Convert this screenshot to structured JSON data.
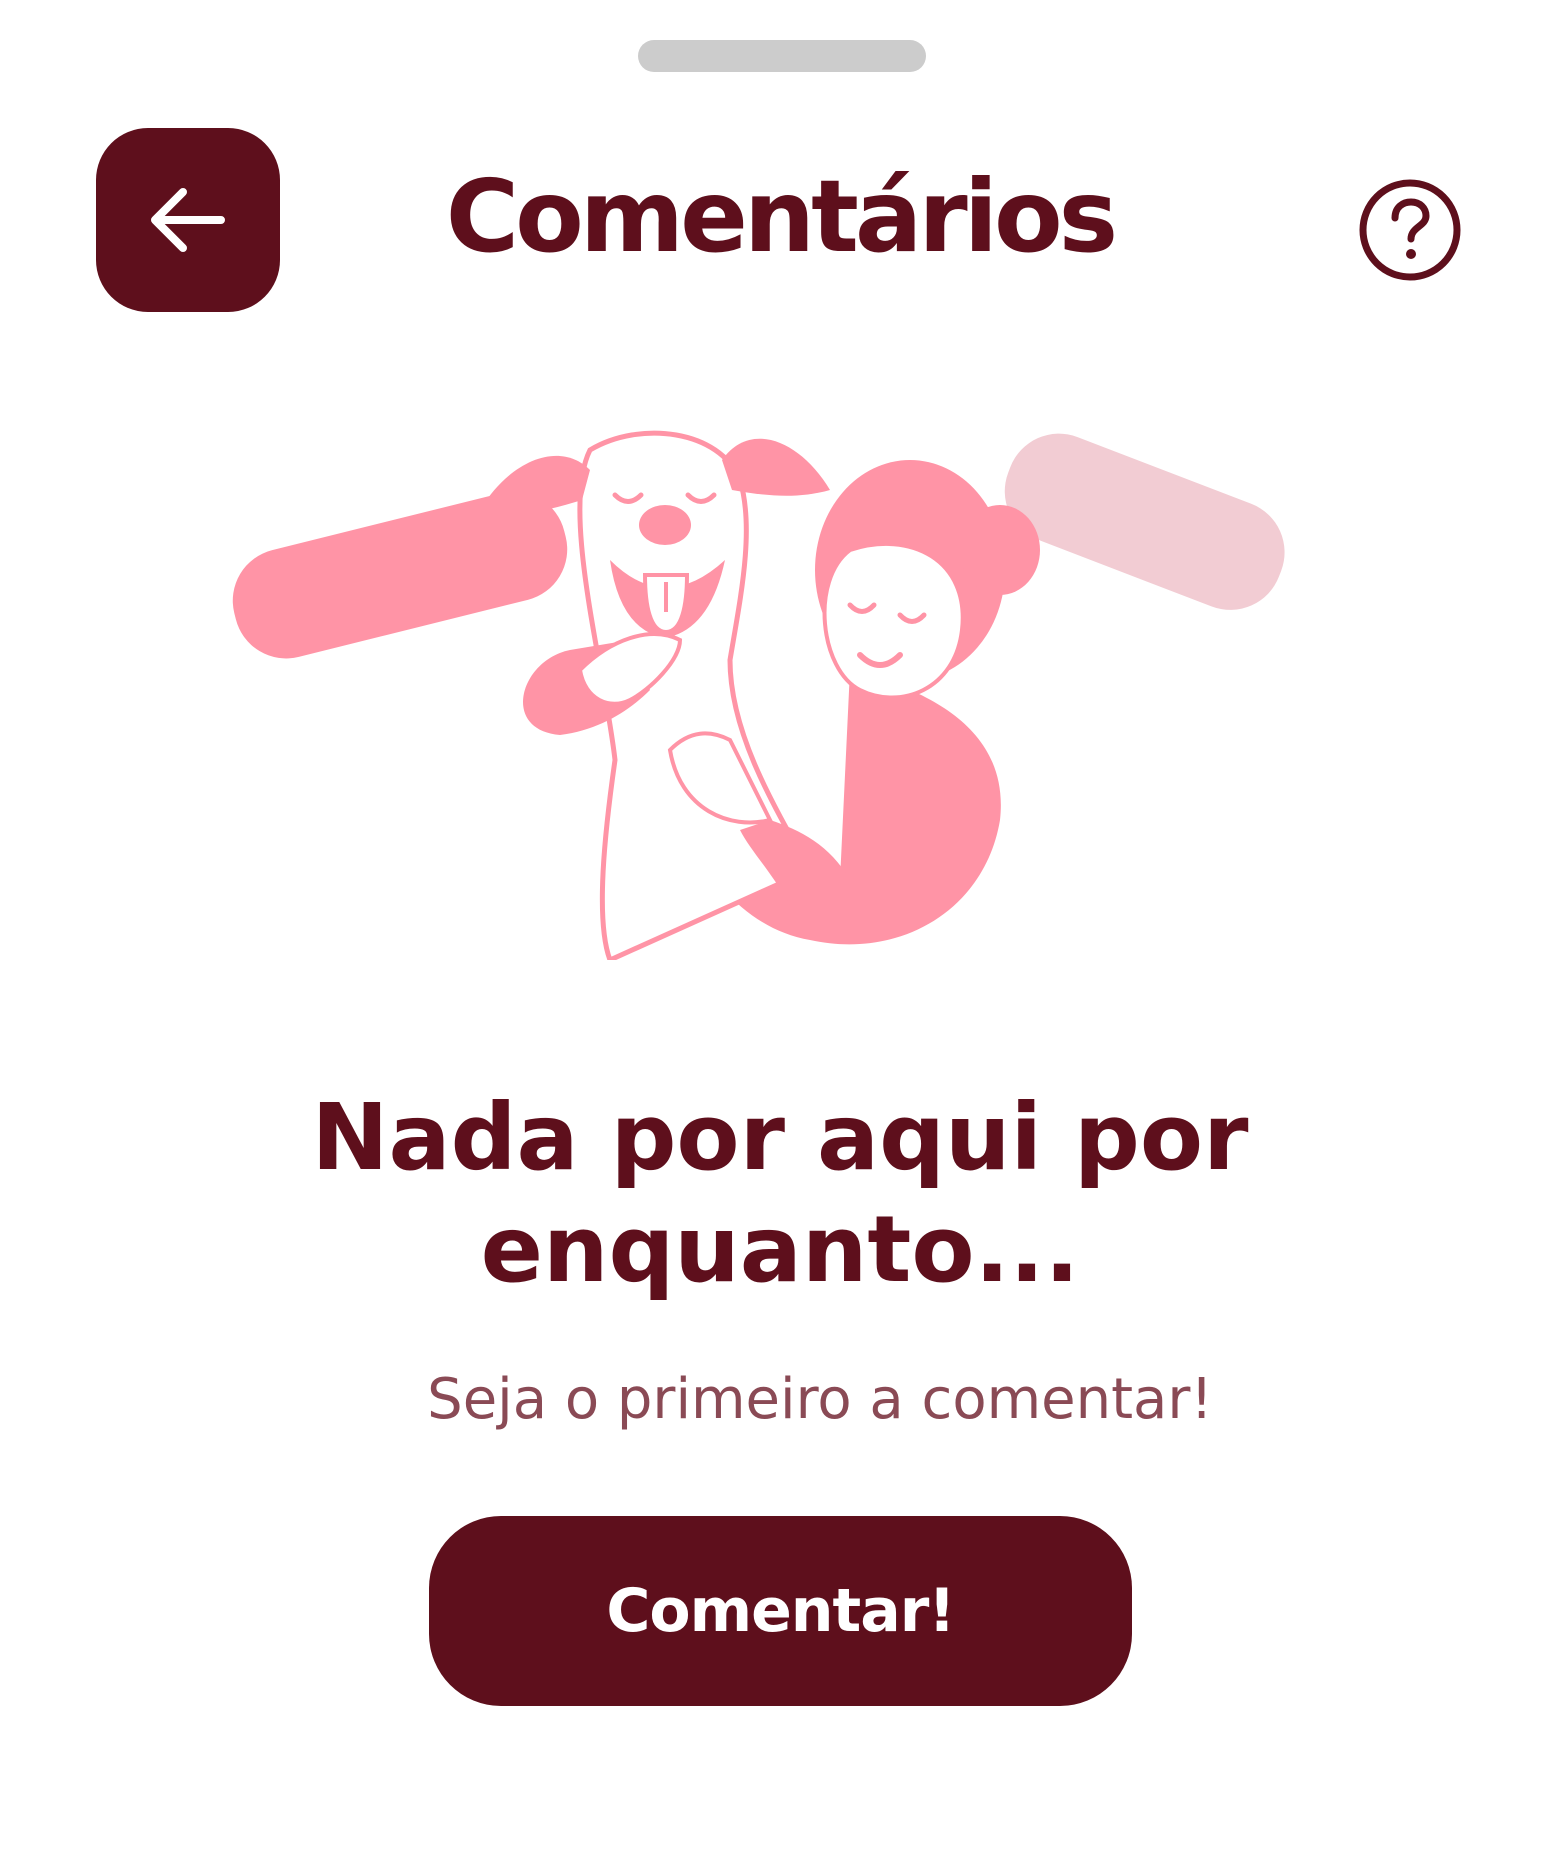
{
  "header": {
    "title": "Comentários",
    "back_icon": "arrow-left-icon",
    "help_icon": "question-circle-icon"
  },
  "empty_state": {
    "title_line1": "Nada por aqui por",
    "title_line2": "enquanto...",
    "subtitle": "Seja o primeiro a comentar!",
    "illustration": "person-hugging-dog-illustration"
  },
  "actions": {
    "comment_label": "Comentar!"
  },
  "colors": {
    "primary": "#5e0f1c",
    "accent_pink": "#ff94a6",
    "light_pink": "#f2ccd3",
    "subtitle_text": "#8a4a55",
    "handle": "#cccccc"
  }
}
